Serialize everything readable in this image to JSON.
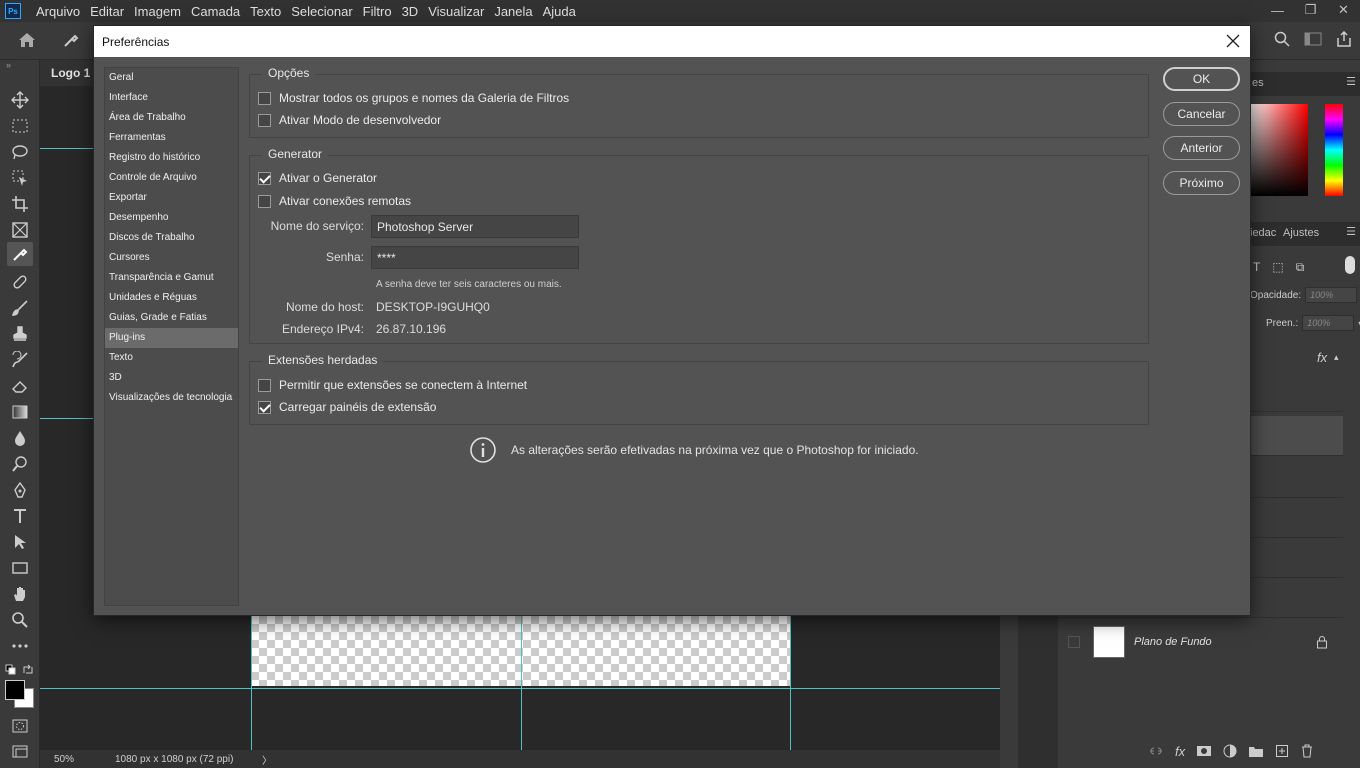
{
  "app": {
    "logo": "Ps",
    "menu": [
      "Arquivo",
      "Editar",
      "Imagem",
      "Camada",
      "Texto",
      "Selecionar",
      "Filtro",
      "3D",
      "Visualizar",
      "Janela",
      "Ajuda"
    ],
    "window_controls": {
      "minimize": "—",
      "restore": "❐",
      "close": "✕"
    }
  },
  "document": {
    "tab": "Logo 1 (",
    "zoom": "50%",
    "info": "1080 px x 1080 px (72 ppi)",
    "info_arrow": "〉"
  },
  "panels": {
    "swatches_tab_fragment": "es",
    "props_tab_fragment": "iedac",
    "adjust_tab": "Ajustes",
    "opacity_label": "Opacidade:",
    "opacity_value": "100%",
    "fill_label": "Preen.:",
    "fill_value": "100%",
    "fx_label": "fx",
    "background_layer": "Plano de Fundo"
  },
  "dialog": {
    "title": "Preferências",
    "nav": [
      "Geral",
      "Interface",
      "Área de Trabalho",
      "Ferramentas",
      "Registro do histórico",
      "Controle de Arquivo",
      "Exportar",
      "Desempenho",
      "Discos de Trabalho",
      "Cursores",
      "Transparência e Gamut",
      "Unidades e Réguas",
      "Guias, Grade e Fatias",
      "Plug-ins",
      "Texto",
      "3D",
      "Visualizações de tecnologia"
    ],
    "selected_nav": "Plug-ins",
    "options": {
      "title": "Opções",
      "show_filter_gallery": {
        "label": "Mostrar todos os grupos e nomes da Galeria de Filtros",
        "checked": false
      },
      "developer_mode": {
        "label": "Ativar Modo de desenvolvedor",
        "checked": false
      }
    },
    "generator": {
      "title": "Generator",
      "enable_generator": {
        "label": "Ativar o Generator",
        "checked": true
      },
      "enable_remote": {
        "label": "Ativar conexões remotas",
        "checked": false
      },
      "service_name_label": "Nome do serviço:",
      "service_name_value": "Photoshop Server",
      "password_label": "Senha:",
      "password_value": "****",
      "password_hint": "A senha deve ter seis caracteres ou mais.",
      "host_label": "Nome do host:",
      "host_value": "DESKTOP-I9GUHQ0",
      "ipv4_label": "Endereço IPv4:",
      "ipv4_value": "26.87.10.196"
    },
    "legacy": {
      "title": "Extensões herdadas",
      "allow_internet": {
        "label": "Permitir que extensões se conectem à Internet",
        "checked": false
      },
      "load_panels": {
        "label": "Carregar painéis de extensão",
        "checked": true
      }
    },
    "info_message": "As alterações serão efetivadas na próxima vez que o Photoshop for iniciado.",
    "buttons": {
      "ok": "OK",
      "cancel": "Cancelar",
      "prev": "Anterior",
      "next": "Próximo"
    }
  },
  "colors": {
    "guide": "#4ec3c3",
    "dialog_bg": "#535353",
    "accent_logo": "#31a8ff"
  }
}
